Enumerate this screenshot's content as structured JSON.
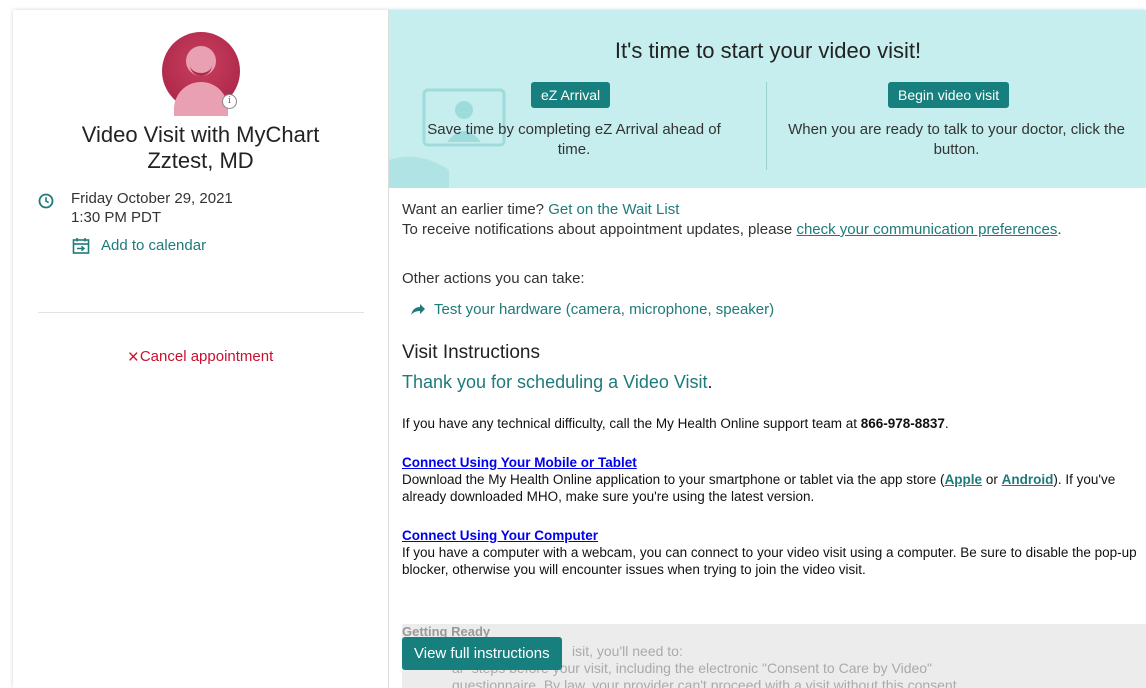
{
  "left": {
    "title_line1": "Video Visit with MyChart",
    "title_line2": "Zztest, MD",
    "date": "Friday October 29, 2021",
    "time": "1:30 PM PDT",
    "add_to_calendar": "Add to calendar",
    "cancel_icon": "×",
    "cancel_label": "Cancel appointment"
  },
  "banner": {
    "title": "It's time to start your video visit!",
    "ez_button": "eZ Arrival",
    "ez_text": "Save time by completing eZ Arrival ahead of time.",
    "begin_button": "Begin video visit",
    "begin_text": "When you are ready to talk to your doctor, click the button."
  },
  "content": {
    "earlier_prefix": "Want an earlier time?",
    "waitlist_link": "Get on the Wait List",
    "notify_prefix": "To receive notifications about appointment updates, please",
    "notify_link": "check your communication preferences",
    "notify_suffix": ".",
    "other_actions": "Other actions you can take:",
    "test_hardware": "Test your hardware (camera, microphone, speaker)",
    "visit_instructions": "Visit Instructions",
    "thanks": "Thank you for scheduling a Video Visit",
    "thanks_dot": ".",
    "difficulty_prefix": "If you have any technical difficulty, call the My Health Online support team at",
    "support_phone": "866-978-8837",
    "difficulty_suffix": ".",
    "mobile_heading": "Connect Using Your Mobile or Tablet",
    "mobile_prefix": "Download the My Health Online application to your smartphone or tablet via the app store (",
    "apple_link": "Apple",
    "mobile_or": "or",
    "android_link": "Android",
    "mobile_suffix": "). If you've already downloaded MHO, make sure you're using the latest version.",
    "computer_heading": "Connect Using Your Computer",
    "computer_text": "If you have a computer with a webcam, you can connect to your video visit using a computer. Be sure to disable the pop-up blocker, otherwise you will encounter issues when trying to join the video visit."
  },
  "fade": {
    "title": "Getting Ready",
    "line1": "isit, you'll need to:",
    "line2": "al\" steps before your visit, including the electronic \"Consent to Care by Video\"",
    "line3": "questionnaire. By law, your provider can't proceed with a visit without this consent."
  },
  "view_full_button": "View full instructions"
}
